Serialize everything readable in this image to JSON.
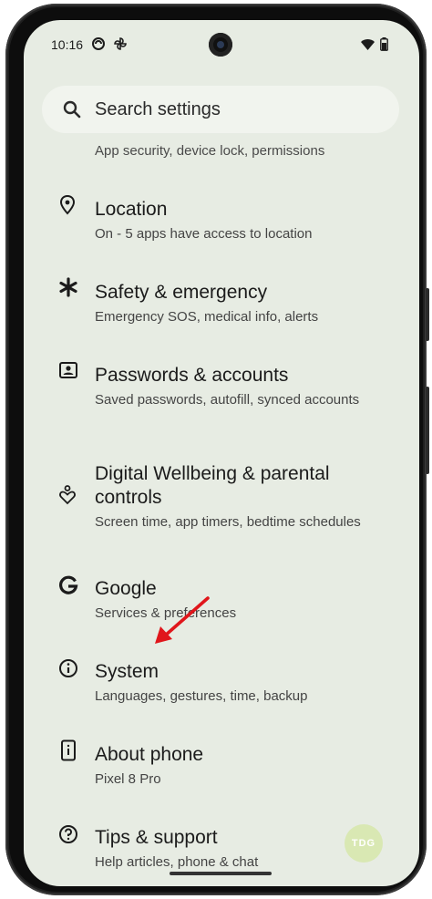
{
  "status_bar": {
    "time": "10:16",
    "icons": [
      "data-saver-icon",
      "pinwheel-icon",
      "wifi-icon",
      "battery-icon"
    ]
  },
  "search": {
    "placeholder": "Search settings"
  },
  "partial_item": {
    "subtitle": "App security, device lock, permissions"
  },
  "settings": [
    {
      "icon": "location-pin-icon",
      "title": "Location",
      "subtitle": "On - 5 apps have access to location"
    },
    {
      "icon": "asterisk-icon",
      "title": "Safety & emergency",
      "subtitle": "Emergency SOS, medical info, alerts"
    },
    {
      "icon": "account-box-icon",
      "title": "Passwords & accounts",
      "subtitle": "Saved passwords, autofill, synced accounts"
    },
    {
      "icon": "wellbeing-icon",
      "title": "Digital Wellbeing & parental controls",
      "subtitle": "Screen time, app timers, bedtime schedules"
    },
    {
      "icon": "google-g-icon",
      "title": "Google",
      "subtitle": "Services & preferences"
    },
    {
      "icon": "info-icon",
      "title": "System",
      "subtitle": "Languages, gestures, time, backup"
    },
    {
      "icon": "phone-info-icon",
      "title": "About phone",
      "subtitle": "Pixel 8 Pro"
    },
    {
      "icon": "help-icon",
      "title": "Tips & support",
      "subtitle": "Help articles, phone & chat"
    }
  ],
  "watermark": "TDG",
  "colors": {
    "background": "#e7ece3",
    "search_bg": "#f1f4ee",
    "arrow": "#e0161b"
  }
}
